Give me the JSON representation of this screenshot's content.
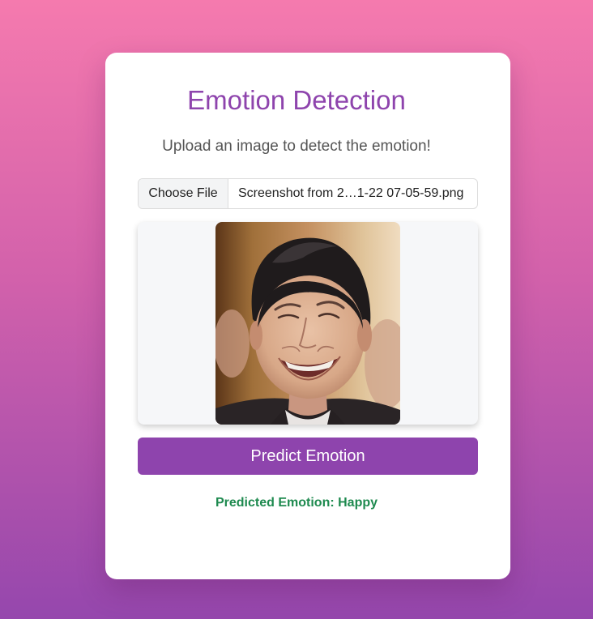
{
  "page": {
    "title": "Emotion Detection",
    "subtitle": "Upload an image to detect the emotion!"
  },
  "upload": {
    "button_label": "Choose File",
    "file_name": "Screenshot from 2…1-22 07-05-59.png"
  },
  "preview": {
    "image_description_icon": "face-photo"
  },
  "action": {
    "predict_label": "Predict Emotion"
  },
  "result": {
    "text": "Predicted Emotion: Happy"
  },
  "colors": {
    "accent": "#8e44ad",
    "success": "#1e8a4f",
    "background_top": "#f57aae",
    "background_bottom": "#9547ad"
  }
}
